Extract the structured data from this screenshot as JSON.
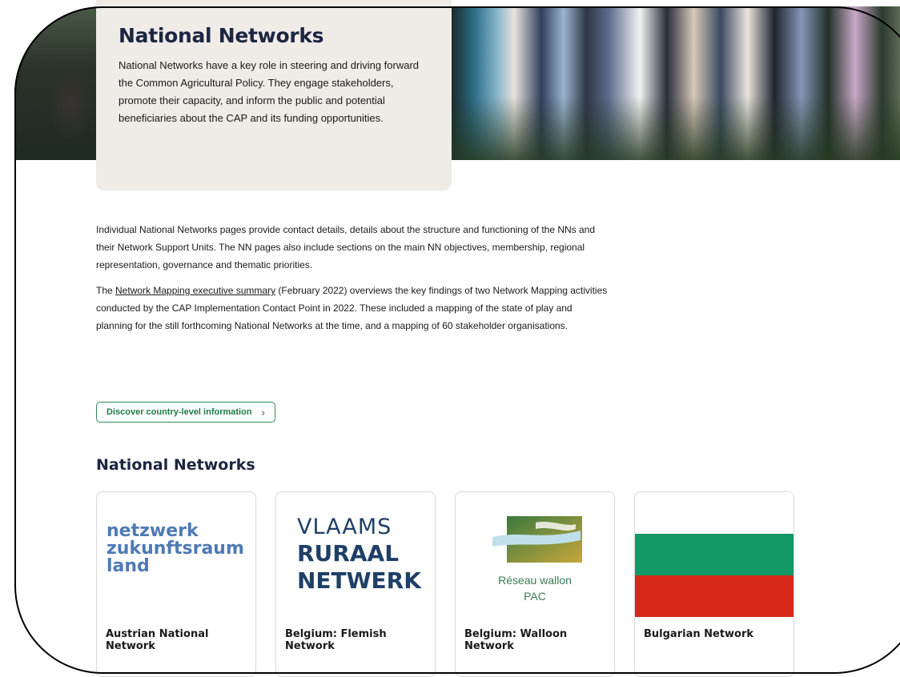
{
  "hero": {
    "title": "National Networks",
    "text": "National Networks have a key role in steering and driving forward the Common Agricultural Policy. They engage stakeholders, promote their capacity, and inform the public and potential beneficiaries about the CAP and its funding opportunities."
  },
  "body": {
    "para1": "Individual National Networks pages provide contact details, details about the structure and functioning of the NNs and their Network Support Units. The NN pages also include sections on the main NN objectives, membership, regional representation, governance and thematic priorities.",
    "para2_prefix": "The ",
    "para2_link": "Network Mapping executive summary",
    "para2_suffix": " (February 2022) overviews the key findings of two Network Mapping activities conducted by the CAP Implementation Contact Point in 2022. These included a mapping of the state of play and planning for the still forthcoming National Networks at the time, and a mapping of 60 stakeholder organisations.",
    "discover_label": "Discover country-level information",
    "discover_icon": "chevron-right-icon"
  },
  "section": {
    "title": "National Networks"
  },
  "cards": [
    {
      "name": "Austrian National Network",
      "logo_lines": [
        "netzwerk",
        "zukunftsraum",
        "land"
      ],
      "logo_color": "#4e7ab5"
    },
    {
      "name": "Belgium: Flemish Network",
      "logo_lines": [
        "VLAAMS",
        "RURAAL",
        "NETWERK"
      ],
      "logo_color": "#1f3f66"
    },
    {
      "name": "Belgium: Walloon Network",
      "logo_lines": [
        "Réseau wallon",
        "PAC"
      ],
      "logo_color": "#3b7a53"
    },
    {
      "name": "Bulgarian Network",
      "flag_colors": [
        "#ffffff",
        "#129966",
        "#d62718"
      ]
    }
  ]
}
